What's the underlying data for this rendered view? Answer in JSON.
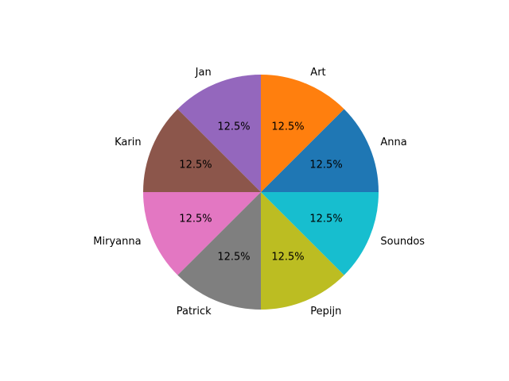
{
  "chart_data": {
    "type": "pie",
    "title": "",
    "slices": [
      {
        "label": "Anna",
        "value": 12.5,
        "pct_label": "12.5%",
        "color": "#1f77b4"
      },
      {
        "label": "Art",
        "value": 12.5,
        "pct_label": "12.5%",
        "color": "#ff7f0e"
      },
      {
        "label": "Jan",
        "value": 12.5,
        "pct_label": "12.5%",
        "color": "#9467bd"
      },
      {
        "label": "Karin",
        "value": 12.5,
        "pct_label": "12.5%",
        "color": "#8c564b"
      },
      {
        "label": "Miryanna",
        "value": 12.5,
        "pct_label": "12.5%",
        "color": "#e377c2"
      },
      {
        "label": "Patrick",
        "value": 12.5,
        "pct_label": "12.5%",
        "color": "#7f7f7f"
      },
      {
        "label": "Pepijn",
        "value": 12.5,
        "pct_label": "12.5%",
        "color": "#bcbd22"
      },
      {
        "label": "Soundos",
        "value": 12.5,
        "pct_label": "12.5%",
        "color": "#17becf"
      }
    ],
    "start_angle_deg": 0,
    "direction": "counterclockwise",
    "legend": "none"
  }
}
